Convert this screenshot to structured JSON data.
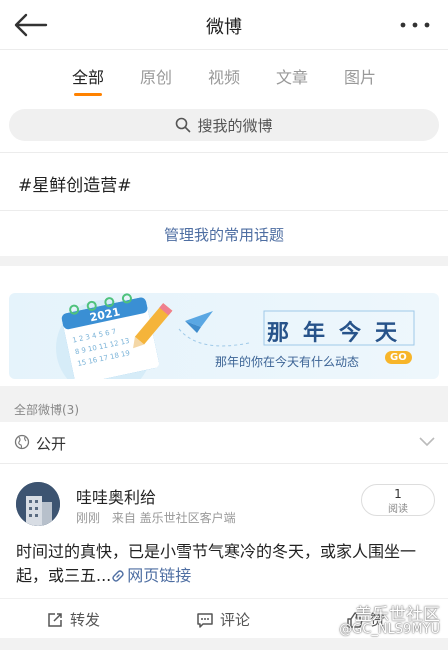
{
  "header": {
    "title": "微博"
  },
  "tabs": [
    {
      "label": "全部"
    },
    {
      "label": "原创"
    },
    {
      "label": "视频"
    },
    {
      "label": "文章"
    },
    {
      "label": "图片"
    }
  ],
  "search": {
    "placeholder": "搜我的微博"
  },
  "topic": {
    "text": "#星鲜创造营#"
  },
  "manage": {
    "label": "管理我的常用话题"
  },
  "banner": {
    "year": "2021",
    "title": "那年今天",
    "subtitle": "那年的你在今天有什么动态",
    "go": "GO"
  },
  "count": {
    "label": "全部微博(3)"
  },
  "privacy": {
    "label": "公开"
  },
  "post": {
    "username": "哇哇奥利给",
    "time": "刚刚",
    "source": "来自 盖乐世社区客户端",
    "read_count": "1",
    "read_label": "阅读",
    "text": "时间过的真快，已是小雪节气寒冷的冬天，或家人围坐一起，或三五...",
    "link": "网页链接"
  },
  "actions": {
    "repost": "转发",
    "comment": "评论",
    "like": "赞"
  },
  "watermark": {
    "line1": "盖乐世社区",
    "line2": "@GC_NLS9MYU"
  },
  "colors": {
    "accent": "#ff8200",
    "link": "#4e6ea2"
  }
}
